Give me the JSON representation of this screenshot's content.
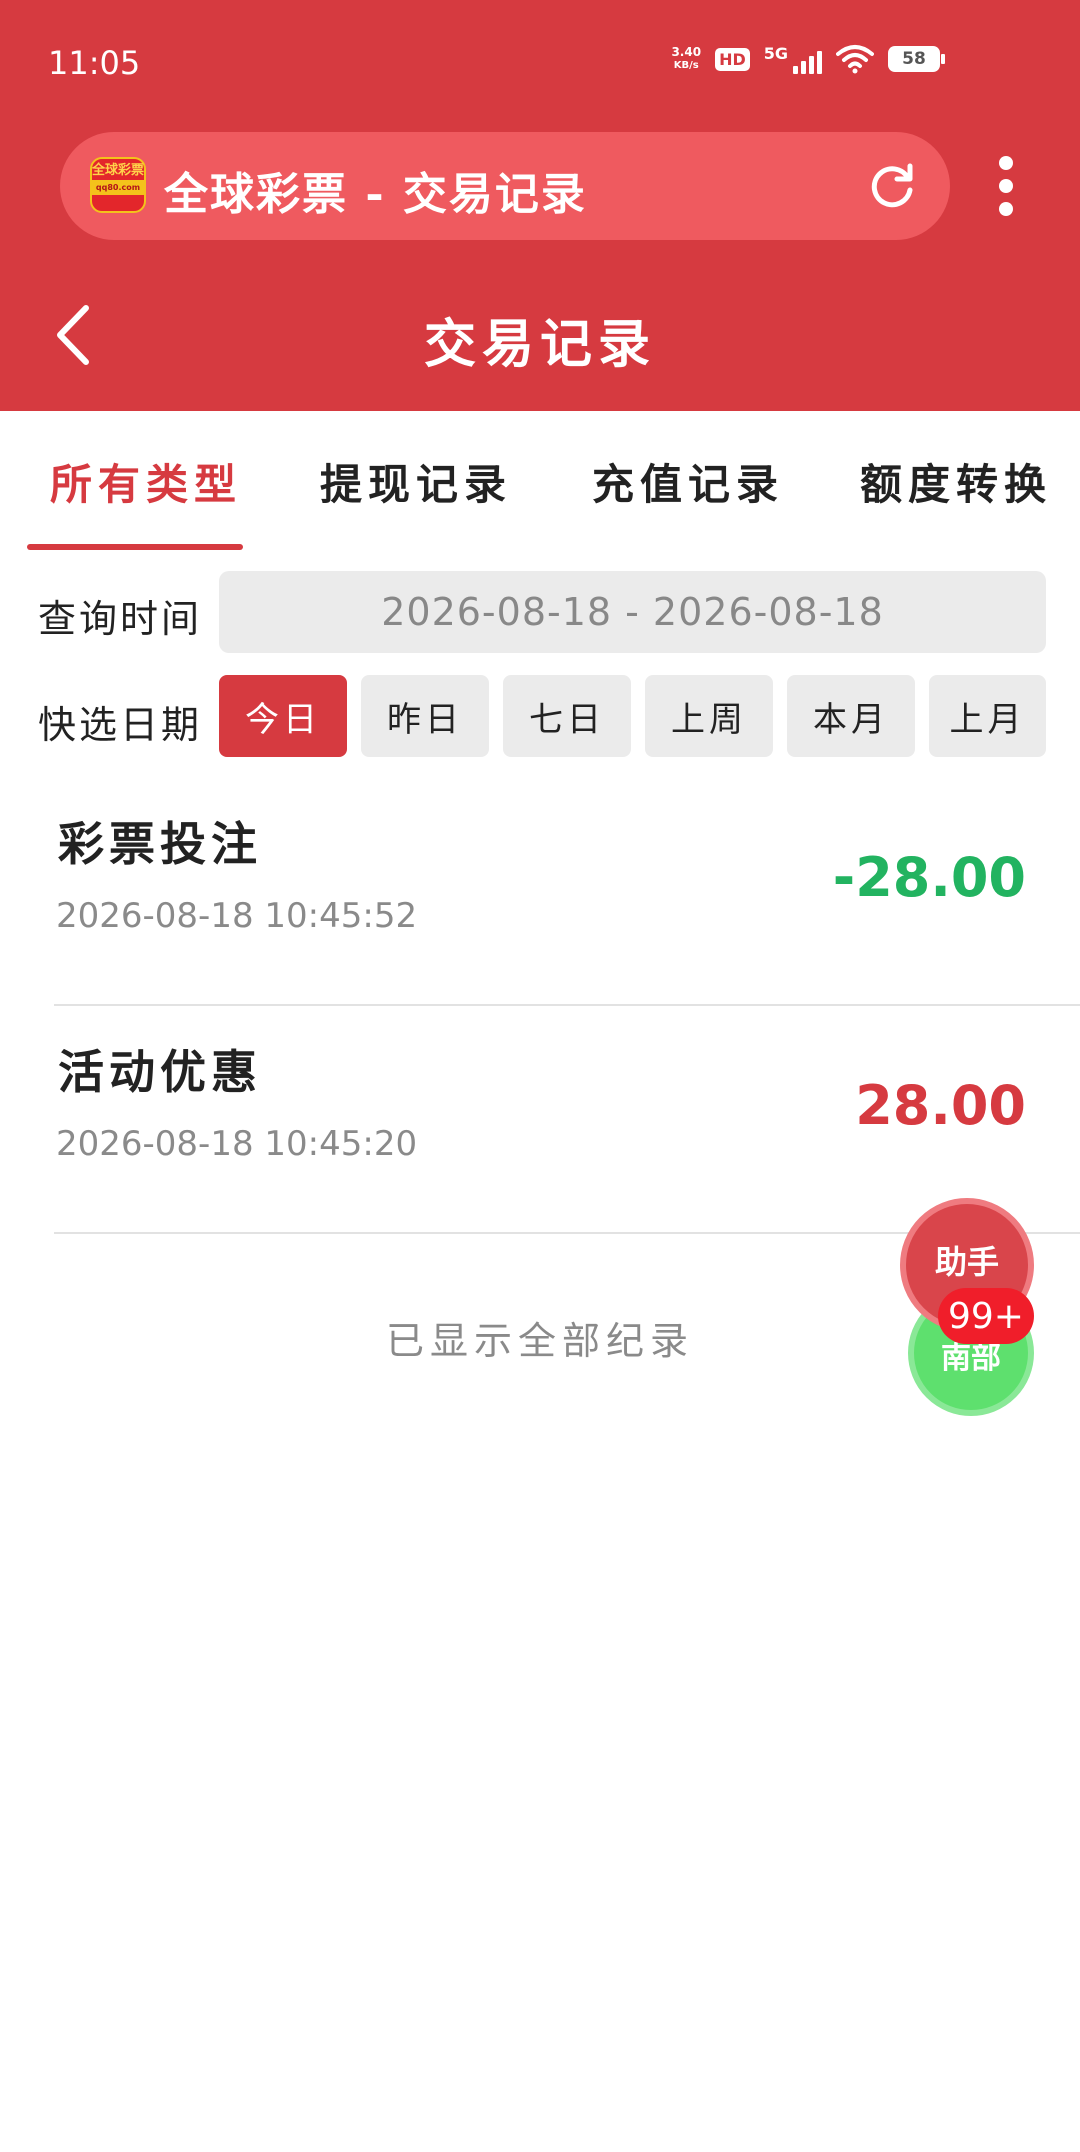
{
  "status_bar": {
    "time": "11:05",
    "net_speed_value": "3.40",
    "net_speed_unit": "KB/s",
    "hd": "HD",
    "network": "5G",
    "battery": "58"
  },
  "browser": {
    "logo_text": "全球彩票",
    "logo_sub": "qq80.com",
    "title": "全球彩票 - 交易记录"
  },
  "header": {
    "title": "交易记录"
  },
  "tabs": [
    {
      "label": "所有类型",
      "active": true
    },
    {
      "label": "提现记录",
      "active": false
    },
    {
      "label": "充值记录",
      "active": false
    },
    {
      "label": "额度转换",
      "active": false
    }
  ],
  "filters": {
    "query_label": "查询时间",
    "date_range": "2026-08-18 - 2026-08-18",
    "quick_label": "快选日期",
    "quick_options": [
      "今日",
      "昨日",
      "七日",
      "上周",
      "本月",
      "上月"
    ],
    "selected_quick": "今日"
  },
  "records": [
    {
      "title": "彩票投注",
      "time": "2026-08-18 10:45:52",
      "amount": "-28.00",
      "amount_color": "#22b360"
    },
    {
      "title": "活动优惠",
      "time": "2026-08-18 10:45:20",
      "amount": "28.00",
      "amount_color": "#d63a40"
    }
  ],
  "footer_note": "已显示全部纪录",
  "floating": {
    "assistant_label": "助手",
    "club_label": "南部",
    "badge": "99+"
  },
  "colors": {
    "brand": "#d63a40",
    "negative": "#22b360",
    "positive": "#d63a40"
  }
}
